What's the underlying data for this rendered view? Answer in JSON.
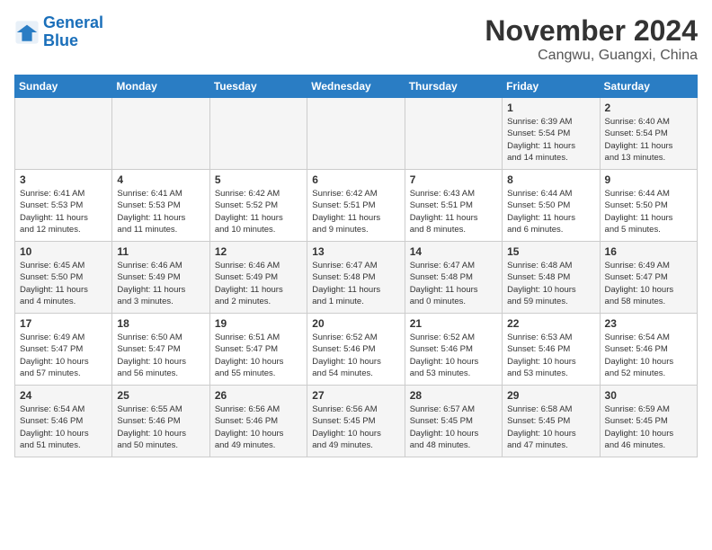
{
  "logo": {
    "line1": "General",
    "line2": "Blue"
  },
  "title": "November 2024",
  "subtitle": "Cangwu, Guangxi, China",
  "weekdays": [
    "Sunday",
    "Monday",
    "Tuesday",
    "Wednesday",
    "Thursday",
    "Friday",
    "Saturday"
  ],
  "weeks": [
    [
      {
        "day": "",
        "info": ""
      },
      {
        "day": "",
        "info": ""
      },
      {
        "day": "",
        "info": ""
      },
      {
        "day": "",
        "info": ""
      },
      {
        "day": "",
        "info": ""
      },
      {
        "day": "1",
        "info": "Sunrise: 6:39 AM\nSunset: 5:54 PM\nDaylight: 11 hours\nand 14 minutes."
      },
      {
        "day": "2",
        "info": "Sunrise: 6:40 AM\nSunset: 5:54 PM\nDaylight: 11 hours\nand 13 minutes."
      }
    ],
    [
      {
        "day": "3",
        "info": "Sunrise: 6:41 AM\nSunset: 5:53 PM\nDaylight: 11 hours\nand 12 minutes."
      },
      {
        "day": "4",
        "info": "Sunrise: 6:41 AM\nSunset: 5:53 PM\nDaylight: 11 hours\nand 11 minutes."
      },
      {
        "day": "5",
        "info": "Sunrise: 6:42 AM\nSunset: 5:52 PM\nDaylight: 11 hours\nand 10 minutes."
      },
      {
        "day": "6",
        "info": "Sunrise: 6:42 AM\nSunset: 5:51 PM\nDaylight: 11 hours\nand 9 minutes."
      },
      {
        "day": "7",
        "info": "Sunrise: 6:43 AM\nSunset: 5:51 PM\nDaylight: 11 hours\nand 8 minutes."
      },
      {
        "day": "8",
        "info": "Sunrise: 6:44 AM\nSunset: 5:50 PM\nDaylight: 11 hours\nand 6 minutes."
      },
      {
        "day": "9",
        "info": "Sunrise: 6:44 AM\nSunset: 5:50 PM\nDaylight: 11 hours\nand 5 minutes."
      }
    ],
    [
      {
        "day": "10",
        "info": "Sunrise: 6:45 AM\nSunset: 5:50 PM\nDaylight: 11 hours\nand 4 minutes."
      },
      {
        "day": "11",
        "info": "Sunrise: 6:46 AM\nSunset: 5:49 PM\nDaylight: 11 hours\nand 3 minutes."
      },
      {
        "day": "12",
        "info": "Sunrise: 6:46 AM\nSunset: 5:49 PM\nDaylight: 11 hours\nand 2 minutes."
      },
      {
        "day": "13",
        "info": "Sunrise: 6:47 AM\nSunset: 5:48 PM\nDaylight: 11 hours\nand 1 minute."
      },
      {
        "day": "14",
        "info": "Sunrise: 6:47 AM\nSunset: 5:48 PM\nDaylight: 11 hours\nand 0 minutes."
      },
      {
        "day": "15",
        "info": "Sunrise: 6:48 AM\nSunset: 5:48 PM\nDaylight: 10 hours\nand 59 minutes."
      },
      {
        "day": "16",
        "info": "Sunrise: 6:49 AM\nSunset: 5:47 PM\nDaylight: 10 hours\nand 58 minutes."
      }
    ],
    [
      {
        "day": "17",
        "info": "Sunrise: 6:49 AM\nSunset: 5:47 PM\nDaylight: 10 hours\nand 57 minutes."
      },
      {
        "day": "18",
        "info": "Sunrise: 6:50 AM\nSunset: 5:47 PM\nDaylight: 10 hours\nand 56 minutes."
      },
      {
        "day": "19",
        "info": "Sunrise: 6:51 AM\nSunset: 5:47 PM\nDaylight: 10 hours\nand 55 minutes."
      },
      {
        "day": "20",
        "info": "Sunrise: 6:52 AM\nSunset: 5:46 PM\nDaylight: 10 hours\nand 54 minutes."
      },
      {
        "day": "21",
        "info": "Sunrise: 6:52 AM\nSunset: 5:46 PM\nDaylight: 10 hours\nand 53 minutes."
      },
      {
        "day": "22",
        "info": "Sunrise: 6:53 AM\nSunset: 5:46 PM\nDaylight: 10 hours\nand 53 minutes."
      },
      {
        "day": "23",
        "info": "Sunrise: 6:54 AM\nSunset: 5:46 PM\nDaylight: 10 hours\nand 52 minutes."
      }
    ],
    [
      {
        "day": "24",
        "info": "Sunrise: 6:54 AM\nSunset: 5:46 PM\nDaylight: 10 hours\nand 51 minutes."
      },
      {
        "day": "25",
        "info": "Sunrise: 6:55 AM\nSunset: 5:46 PM\nDaylight: 10 hours\nand 50 minutes."
      },
      {
        "day": "26",
        "info": "Sunrise: 6:56 AM\nSunset: 5:46 PM\nDaylight: 10 hours\nand 49 minutes."
      },
      {
        "day": "27",
        "info": "Sunrise: 6:56 AM\nSunset: 5:45 PM\nDaylight: 10 hours\nand 49 minutes."
      },
      {
        "day": "28",
        "info": "Sunrise: 6:57 AM\nSunset: 5:45 PM\nDaylight: 10 hours\nand 48 minutes."
      },
      {
        "day": "29",
        "info": "Sunrise: 6:58 AM\nSunset: 5:45 PM\nDaylight: 10 hours\nand 47 minutes."
      },
      {
        "day": "30",
        "info": "Sunrise: 6:59 AM\nSunset: 5:45 PM\nDaylight: 10 hours\nand 46 minutes."
      }
    ]
  ]
}
